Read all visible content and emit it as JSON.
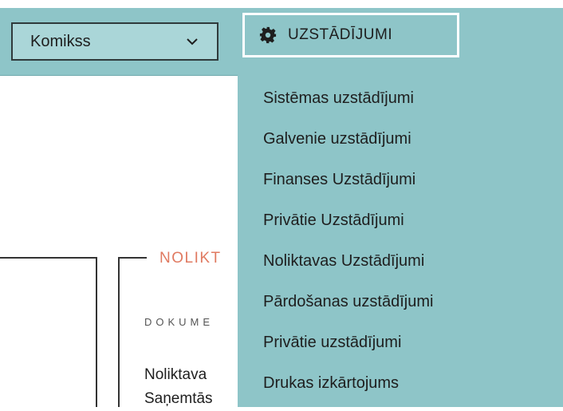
{
  "top_strip_text": "",
  "navbar": {
    "company_select": {
      "value": "Komikss",
      "icon": "chevron-down-icon"
    },
    "settings_button": {
      "label": "UZSTĀDĪJUMI",
      "icon": "gear-icon"
    }
  },
  "dropdown": {
    "items": [
      "Sistēmas uzstādījumi",
      "Galvenie uzstādījumi",
      "Finanses Uzstādījumi",
      "Privātie Uzstādījumi",
      "Noliktavas Uzstādījumi",
      "Pārdošanas uzstādījumi",
      "Privātie uzstādījumi",
      "Drukas izkārtojums"
    ]
  },
  "background": {
    "section_title": "NOLIKT",
    "doc_label": "DOKUME",
    "lines": [
      "Noliktava",
      "Saņemtās"
    ]
  },
  "colors": {
    "navbar": "#8ec5c8",
    "select_bg": "#aad6d8",
    "accent": "#e07a61"
  }
}
